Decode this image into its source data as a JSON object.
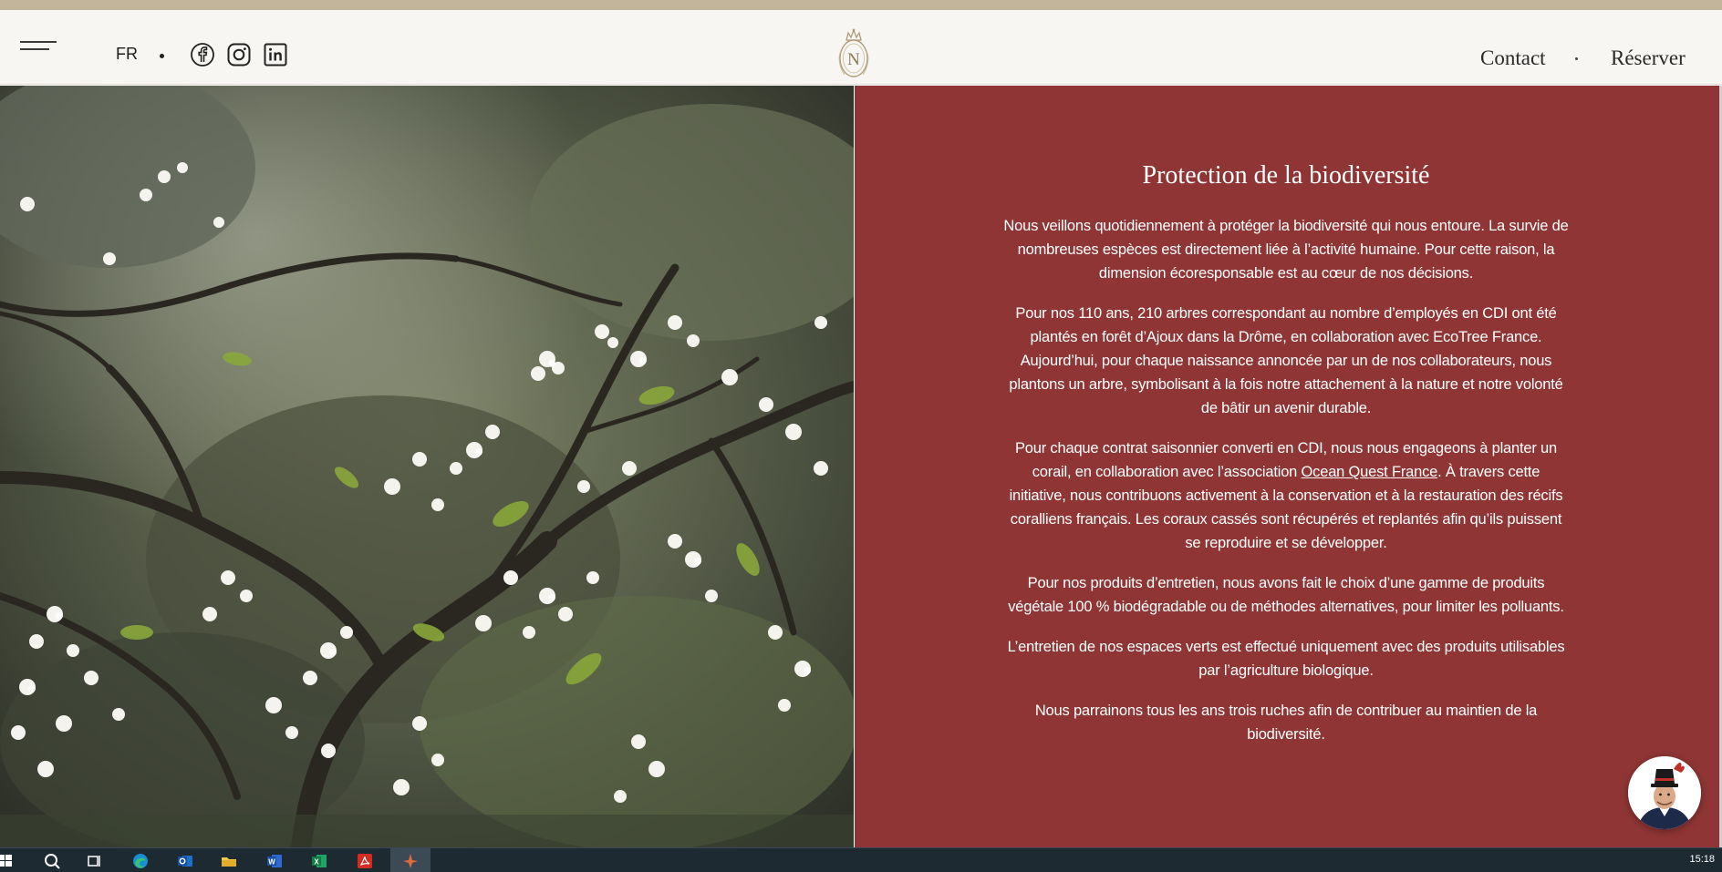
{
  "header": {
    "language": "FR",
    "social_icons": [
      "facebook-icon",
      "instagram-icon",
      "linkedin-icon"
    ],
    "logo_letter": "N",
    "nav": {
      "contact": "Contact",
      "reserve": "Réserver"
    }
  },
  "section": {
    "title": "Protection de la biodiversité",
    "p1": "Nous veillons quotidiennement à protéger la biodiversité qui nous entoure. La survie de nombreuses espèces est directement liée à l’activité humaine. Pour cette raison, la dimension écoresponsable est au cœur de nos décisions.",
    "p2": "Pour nos 110 ans, 210 arbres correspondant au nombre d’employés en CDI ont été plantés en forêt d’Ajoux dans la Drôme, en collaboration avec EcoTree France. Aujourd’hui, pour chaque naissance annoncée par un de nos collaborateurs, nous plantons un arbre, symbolisant à la fois notre attachement à la nature et notre volonté de bâtir un avenir durable.",
    "p3_before": "Pour chaque contrat saisonnier converti en CDI, nous nous engageons à planter un corail, en collaboration avec l’association ",
    "p3_link": "Ocean Quest France",
    "p3_after": ". À travers cette initiative, nous contribuons activement à la conservation et à la restauration des récifs coralliens français. Les coraux cassés sont récupérés et replantés afin qu’ils puissent se reproduire et se développer.",
    "p4": "Pour nos produits d’entretien, nous avons fait le choix d’une gamme de produits végétale 100 % biodégradable ou de méthodes alternatives, pour limiter les polluants.",
    "p5": "L’entretien de nos espaces verts est effectué uniquement avec des produits utilisables par l’agriculture biologique.",
    "p6": "Nous parrainons tous les ans trois ruches afin de contribuer au maintien de la biodiversité."
  },
  "colors": {
    "panel": "#8f3535",
    "top_band": "#c2b59c",
    "header_bg": "#f7f6f3"
  },
  "taskbar": {
    "icons": [
      "windows-start-icon",
      "search-icon",
      "task-view-icon",
      "edge-icon",
      "outlook-icon",
      "file-explorer-icon",
      "word-icon",
      "excel-icon",
      "acrobat-icon",
      "active-app-icon"
    ],
    "time": "15:18"
  }
}
